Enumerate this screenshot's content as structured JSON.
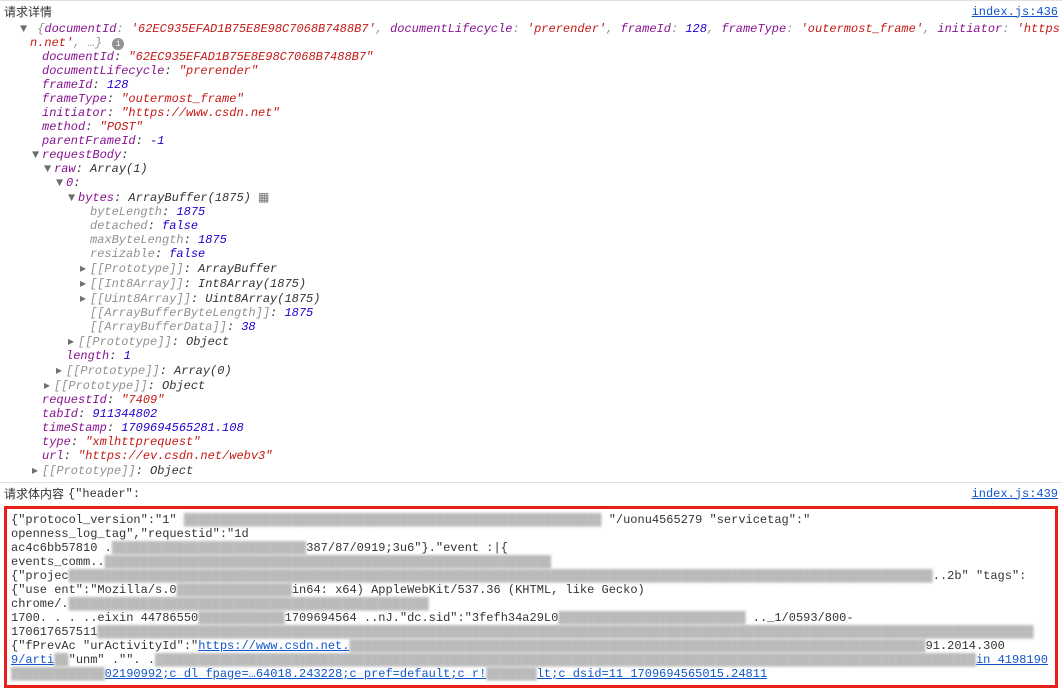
{
  "header1": {
    "title": "请求详情",
    "source_link": "index.js:436"
  },
  "summary": {
    "documentId_key": "documentId",
    "documentId_val": "'62EC935EFAD1B75E8E98C7068B7488B7'",
    "documentLifecycle_key": "documentLifecycle",
    "documentLifecycle_val": "'prerender'",
    "frameId_key": "frameId",
    "frameId_val": "128",
    "frameType_key": "frameType",
    "frameType_val": "'outermost_frame'",
    "initiator_key": "initiator",
    "initiator_val_a": "'https://www.csd",
    "initiator_val_b": "n.net'",
    "trail": ", …} ",
    "info": "i"
  },
  "fields": {
    "documentId": {
      "k": "documentId",
      "v": "\"62EC935EFAD1B75E8E98C7068B7488B7\""
    },
    "documentLifecycle": {
      "k": "documentLifecycle",
      "v": "\"prerender\""
    },
    "frameId": {
      "k": "frameId",
      "v": "128"
    },
    "frameType": {
      "k": "frameType",
      "v": "\"outermost_frame\""
    },
    "initiator": {
      "k": "initiator",
      "v": "\"https://www.csdn.net\""
    },
    "method": {
      "k": "method",
      "v": "\"POST\""
    },
    "parentFrameId": {
      "k": "parentFrameId",
      "v": "-1"
    },
    "requestBody": {
      "k": "requestBody"
    },
    "raw": {
      "k": "raw",
      "v": "Array(1)"
    },
    "idx0": {
      "k": "0"
    },
    "bytes": {
      "k": "bytes",
      "v": "ArrayBuffer(1875)"
    },
    "byteLength": {
      "k": "byteLength",
      "v": "1875"
    },
    "detached": {
      "k": "detached",
      "v": "false"
    },
    "maxByteLength": {
      "k": "maxByteLength",
      "v": "1875"
    },
    "resizable": {
      "k": "resizable",
      "v": "false"
    },
    "proto1": {
      "k": "[[Prototype]]",
      "v": "ArrayBuffer"
    },
    "int8": {
      "k": "[[Int8Array]]",
      "v": "Int8Array(1875)"
    },
    "uint8": {
      "k": "[[Uint8Array]]",
      "v": "Uint8Array(1875)"
    },
    "abbl": {
      "k": "[[ArrayBufferByteLength]]",
      "v": "1875"
    },
    "abd": {
      "k": "[[ArrayBufferData]]",
      "v": "38"
    },
    "proto2": {
      "k": "[[Prototype]]",
      "v": "Object"
    },
    "length": {
      "k": "length",
      "v": "1"
    },
    "proto3": {
      "k": "[[Prototype]]",
      "v": "Array(0)"
    },
    "proto4": {
      "k": "[[Prototype]]",
      "v": "Object"
    },
    "requestId": {
      "k": "requestId",
      "v": "\"7409\""
    },
    "tabId": {
      "k": "tabId",
      "v": "911344802"
    },
    "timeStamp": {
      "k": "timeStamp",
      "v": "1709694565281.108"
    },
    "type": {
      "k": "type",
      "v": "\"xmlhttprequest\""
    },
    "url": {
      "k": "url",
      "v": "\"https://ev.csdn.net/webv3\""
    },
    "proto5": {
      "k": "[[Prototype]]",
      "v": "Object"
    }
  },
  "header2": {
    "title": "请求体内容",
    "preview": "{\"header\":",
    "source_link": "index.js:439"
  },
  "body": {
    "l1a": "{\"protocol_version\":\"1\" ",
    "l1b": " \"/uonu4565279 \"servicetag\":\" openness_log_tag\",\"requestid\":\"1d",
    "l2a": "ac4c6bb57810   .",
    "l2b": "387/87/0919;3u6\"}.\"event :|{ events_comm..",
    "l3a": "{\"projec",
    "l3b": "..2b\" \"tags\":",
    "l4a": "{\"use  ent\":\"Mozilla/s.0",
    "l4b": "in64: x64) AppleWebKit/537.36 (KHTML, like Gecko) chrome/.",
    "l5a": "1700.          . . ..eixin 44786550",
    "l5b": "1709694564     ..nJ.\"dc.sid\":\"3fefh34a29L0",
    "l5c": "  .._1/0593/800-",
    "l6a": "170617657511",
    "l7a": "{\"fPrevAc           \"urActivityId\":\"",
    "l7b": "https://www.csdn.net.",
    "l7c": "91.2014.300",
    "l8a": "9/arti",
    "l8b": "\"unm\" .\"\". .",
    "l8c": "in 4198190",
    "l9a": "02190992;c dl fpage=…64018.243228;c pref=default;c r!",
    "l9b": "lt;c dsid=11 1709694565015.24811"
  }
}
